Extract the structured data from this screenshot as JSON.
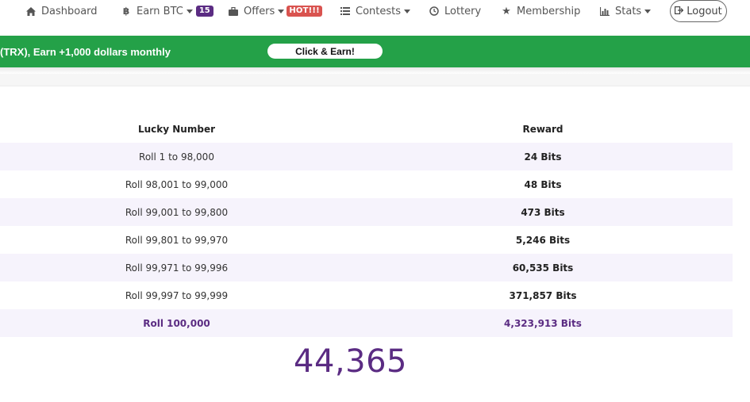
{
  "nav": {
    "dashboard": {
      "icon": "home-icon",
      "label": "Dashboard"
    },
    "earn_btc": {
      "icon": "bitcoin-icon",
      "label": "Earn BTC",
      "badge": "15"
    },
    "offers": {
      "icon": "briefcase-icon",
      "label": "Offers",
      "badge": "HOT!!!"
    },
    "contests": {
      "icon": "list-icon",
      "label": "Contests"
    },
    "lottery": {
      "icon": "clock-icon",
      "label": "Lottery"
    },
    "membership": {
      "icon": "star-icon",
      "label": "Membership"
    },
    "stats": {
      "icon": "bar-chart-icon",
      "label": "Stats"
    },
    "logout": {
      "icon": "sign-out-icon",
      "label": "Logout"
    }
  },
  "promo": {
    "text": "(TRX), Earn +1,000 dollars monthly",
    "button": "Click & Earn!",
    "color": "#24a148"
  },
  "table": {
    "headers": {
      "lucky_number": "Lucky Number",
      "reward": "Reward"
    },
    "rows": [
      {
        "lucky": "Roll 1 to 98,000",
        "reward": "24 Bits"
      },
      {
        "lucky": "Roll 98,001 to 99,000",
        "reward": "48 Bits"
      },
      {
        "lucky": "Roll 99,001 to 99,800",
        "reward": "473 Bits"
      },
      {
        "lucky": "Roll 99,801 to 99,970",
        "reward": "5,246 Bits"
      },
      {
        "lucky": "Roll 99,971 to 99,996",
        "reward": "60,535 Bits"
      },
      {
        "lucky": "Roll 99,997 to 99,999",
        "reward": "371,857 Bits"
      },
      {
        "lucky": "Roll 100,000",
        "reward": "4,323,913 Bits"
      }
    ]
  },
  "result_number": "44,365",
  "colors": {
    "accent": "#5b2c83",
    "row_stripe": "#f6f3fc",
    "hot_badge": "#d9534f"
  }
}
